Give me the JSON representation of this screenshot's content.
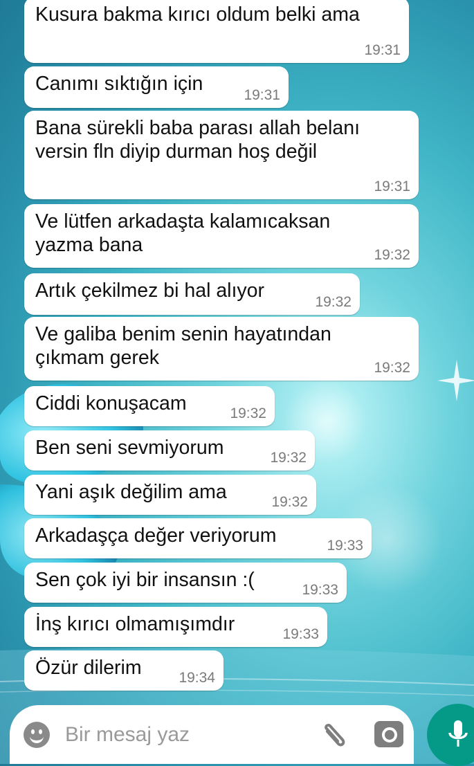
{
  "messages": [
    {
      "text": "Kusura bakma kırıcı oldum belki ama",
      "time": "19:31"
    },
    {
      "text": "Canımı sıktığın için",
      "time": "19:31"
    },
    {
      "text": "Bana sürekli baba parası allah belanı\nversin fln diyip durman hoş değil",
      "time": "19:31"
    },
    {
      "text": "Ve lütfen arkadaşta kalamıcaksan\nyazma bana",
      "time": "19:32"
    },
    {
      "text": "Artık çekilmez bi hal alıyor",
      "time": "19:32"
    },
    {
      "text": "Ve galiba benim senin hayatından\nçıkmam gerek",
      "time": "19:32"
    },
    {
      "text": "Ciddi konuşacam",
      "time": "19:32"
    },
    {
      "text": "Ben seni sevmiyorum",
      "time": "19:32"
    },
    {
      "text": "Yani aşık değilim ama",
      "time": "19:32"
    },
    {
      "text": "Arkadaşça değer veriyorum",
      "time": "19:33"
    },
    {
      "text": "Sen çok iyi bir insansın :(",
      "time": "19:33"
    },
    {
      "text": "İnş kırıcı olmamışımdır",
      "time": "19:33"
    },
    {
      "text": "Özür dilerim",
      "time": "19:34"
    }
  ],
  "composer": {
    "placeholder": "Bir mesaj yaz",
    "emoji_icon": "smiley-icon",
    "attach_icon": "paperclip-icon",
    "camera_icon": "camera-icon",
    "mic_icon": "microphone-icon"
  },
  "colors": {
    "bubble": "#ffffff",
    "time_text": "#7a7a7a",
    "mic_button": "#059a88",
    "wallpaper": "#3fb5c6"
  }
}
